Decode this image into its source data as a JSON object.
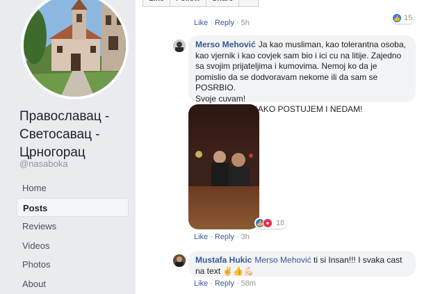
{
  "page": {
    "name": "Православац - Светосавац - Црногорац",
    "handle": "@nasaboka"
  },
  "nav": {
    "items": [
      {
        "label": "Home"
      },
      {
        "label": "Posts"
      },
      {
        "label": "Reviews"
      },
      {
        "label": "Videos"
      },
      {
        "label": "Photos"
      },
      {
        "label": "About"
      }
    ],
    "active": "Posts"
  },
  "post_actions": {
    "like_label": "Like",
    "follow_label": "Follow",
    "share_label": "Share",
    "more_label": "···"
  },
  "comments": [
    {
      "like": "Like",
      "reply": "Reply",
      "time": "5h",
      "reaction_count": "15"
    },
    {
      "author": "Merso Mehović",
      "text": "Ja kao musliman, kao tolerantna osoba, kao vjernik i kao covjek sam bio i ici cu na litije. Zajedno sa svojim prijateljima i kumovima. Nemoj ko da je pomislio da se dodvoravam nekome ili da sam se POSRBIO.\nSvoje cuvam!\nALI TUDJE ITEKAKO POSTUJEM I NEDAM!",
      "like": "Like",
      "reply": "Reply",
      "time": "3h",
      "reaction_count": "18"
    },
    {
      "author": "Mustafa Hukic",
      "mention": "Merso Mehović",
      "text": " ti si Insan!!! I svaka cast na text ✌️👍💪🏻",
      "like": "Like",
      "reply": "Reply",
      "time": "58m"
    }
  ],
  "colors": {
    "link": "#385898",
    "bubble": "#f2f3f5",
    "like_reaction": "#3b78e7",
    "love_reaction": "#f0284a"
  }
}
